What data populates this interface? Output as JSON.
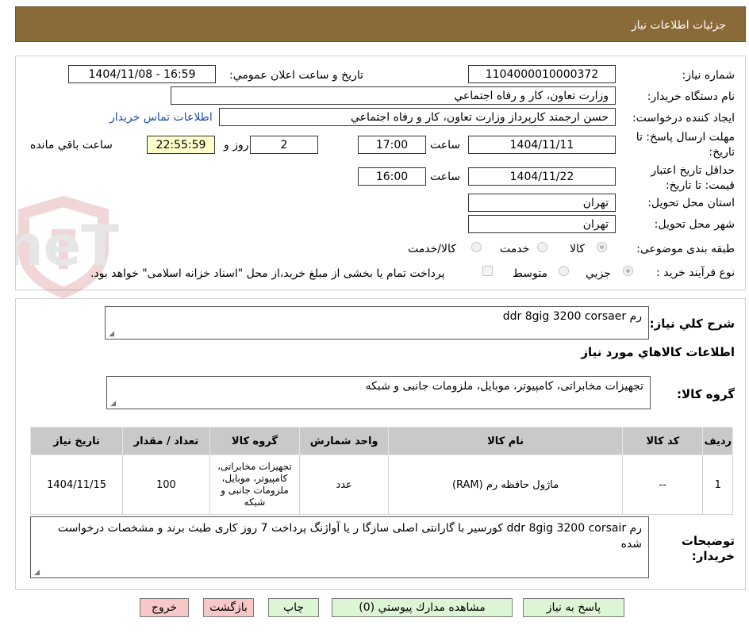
{
  "header": {
    "title": "جزئيات اطلاعات نياز"
  },
  "fields": {
    "need_number_label": "شماره نياز:",
    "need_number": "1104000010000372",
    "announce_label": "تاريخ و ساعت اعلان عمومي:",
    "announce_value": "1404/11/08 - 16:59",
    "buyer_org_label": "نام دستگاه خريدار:",
    "buyer_org": "وزارت تعاون، کار و رفاه اجتماعي",
    "requester_label": "ايجاد کننده درخواست:",
    "requester": "حسن ارجمند کارپرداز وزارت تعاون، کار و رفاه اجتماعي",
    "contact_link": "اطلاعات تماس خريدار",
    "deadline_label_1": "مهلت ارسال پاسخ: تا",
    "deadline_label_2": "تاريخ:",
    "deadline_date": "1404/11/11",
    "time_label": "ساعت",
    "deadline_time": "17:00",
    "days": "2",
    "days_and_label": "روز و",
    "remaining_time": "22:55:59",
    "remaining_label": "ساعت باقي مانده",
    "validity_label_1": "حداقل تاريخ اعتبار",
    "validity_label_2": "قيمت: تا تاريخ:",
    "validity_date": "1404/11/22",
    "validity_time": "16:00",
    "province_label": "استان محل تحويل:",
    "province": "تهران",
    "city_label": "شهر محل تحويل:",
    "city": "تهران",
    "category_label": "طبقه بندی موضوعی:",
    "category_options": [
      "کالا",
      "خدمت",
      "کالا/خدمت"
    ],
    "process_label": "نوع فرآيند خريد :",
    "process_options": [
      "جزيي",
      "متوسط"
    ],
    "payment_note": "پرداخت تمام يا بخشی از مبلغ خريد،از محل \"اسناد خزانه اسلامی\" خواهد بود."
  },
  "summary": {
    "general_desc_label": "شرح کلي نياز:",
    "general_desc": "رم ddr 8gig 3200 corsaer",
    "goods_info_title": "اطلاعات کالاهاي مورد نياز",
    "goods_group_label": "گروه کالا:",
    "goods_group": "تجهيزات مخابراتی، کامپيوتر، موبايل، ملزومات جانبی و شبکه"
  },
  "table": {
    "headers": [
      "رديف",
      "کد کالا",
      "نام کالا",
      "واحد شمارش",
      "گروه کالا",
      "تعداد / مقدار",
      "تاريخ نياز"
    ],
    "rows": [
      {
        "row": "1",
        "code": "--",
        "name": "ماژول حافظه رم (RAM)",
        "unit": "عدد",
        "group": "تجهيزات مخابراتی، کامپيوتر، موبايل، ملزومات جانبی و شبکه",
        "qty": "100",
        "date": "1404/11/15"
      }
    ]
  },
  "buyer_notes": {
    "label_1": "توضيحات",
    "label_2": "خريدار:",
    "text": "رم  ddr 8gig 3200 corsair  کورسير    با گارانتی اصلی سازگا ر يا آواژنگ  پرداخت 7 روز کاری  طبث برند و مشخصات درخواست شده"
  },
  "buttons": {
    "reply": "پاسخ به نياز",
    "attachments": "مشاهده مدارك پيوستي (0)",
    "print": "چاپ",
    "back": "بازگشت",
    "exit": "خروج"
  },
  "watermark": {
    "text": "AriaTender.neT"
  }
}
